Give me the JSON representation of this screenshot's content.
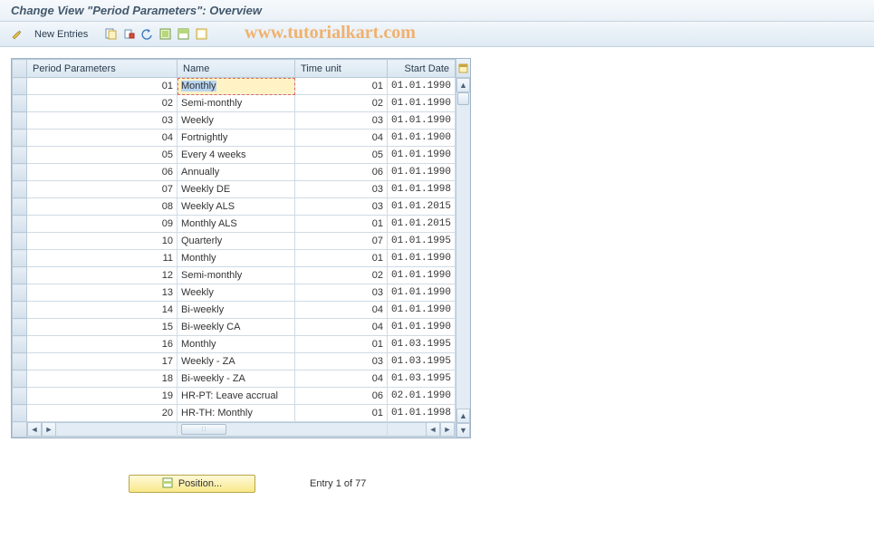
{
  "title": "Change View \"Period Parameters\": Overview",
  "watermark": "www.tutorialkart.com",
  "toolbar": {
    "new_entries_label": "New Entries"
  },
  "columns": {
    "period_parameters": "Period Parameters",
    "name": "Name",
    "time_unit": "Time unit",
    "start_date": "Start Date"
  },
  "rows": [
    {
      "pp": "01",
      "name": "Monthly",
      "tu": "01",
      "sd": "01.01.1990"
    },
    {
      "pp": "02",
      "name": "Semi-monthly",
      "tu": "02",
      "sd": "01.01.1990"
    },
    {
      "pp": "03",
      "name": "Weekly",
      "tu": "03",
      "sd": "01.01.1990"
    },
    {
      "pp": "04",
      "name": "Fortnightly",
      "tu": "04",
      "sd": "01.01.1900"
    },
    {
      "pp": "05",
      "name": "Every 4 weeks",
      "tu": "05",
      "sd": "01.01.1990"
    },
    {
      "pp": "06",
      "name": "Annually",
      "tu": "06",
      "sd": "01.01.1990"
    },
    {
      "pp": "07",
      "name": "Weekly  DE",
      "tu": "03",
      "sd": "01.01.1998"
    },
    {
      "pp": "08",
      "name": "Weekly ALS",
      "tu": "03",
      "sd": "01.01.2015"
    },
    {
      "pp": "09",
      "name": "Monthly ALS",
      "tu": "01",
      "sd": "01.01.2015"
    },
    {
      "pp": "10",
      "name": "Quarterly",
      "tu": "07",
      "sd": "01.01.1995"
    },
    {
      "pp": "11",
      "name": "Monthly",
      "tu": "01",
      "sd": "01.01.1990"
    },
    {
      "pp": "12",
      "name": "Semi-monthly",
      "tu": "02",
      "sd": "01.01.1990"
    },
    {
      "pp": "13",
      "name": "Weekly",
      "tu": "03",
      "sd": "01.01.1990"
    },
    {
      "pp": "14",
      "name": "Bi-weekly",
      "tu": "04",
      "sd": "01.01.1990"
    },
    {
      "pp": "15",
      "name": "Bi-weekly CA",
      "tu": "04",
      "sd": "01.01.1990"
    },
    {
      "pp": "16",
      "name": "Monthly",
      "tu": "01",
      "sd": "01.03.1995"
    },
    {
      "pp": "17",
      "name": "Weekly - ZA",
      "tu": "03",
      "sd": "01.03.1995"
    },
    {
      "pp": "18",
      "name": "Bi-weekly - ZA",
      "tu": "04",
      "sd": "01.03.1995"
    },
    {
      "pp": "19",
      "name": "HR-PT: Leave accrual",
      "tu": "06",
      "sd": "02.01.1990"
    },
    {
      "pp": "20",
      "name": "HR-TH: Monthly",
      "tu": "01",
      "sd": "01.01.1998"
    }
  ],
  "footer": {
    "position_label": "Position...",
    "entry_text": "Entry 1 of 77"
  }
}
